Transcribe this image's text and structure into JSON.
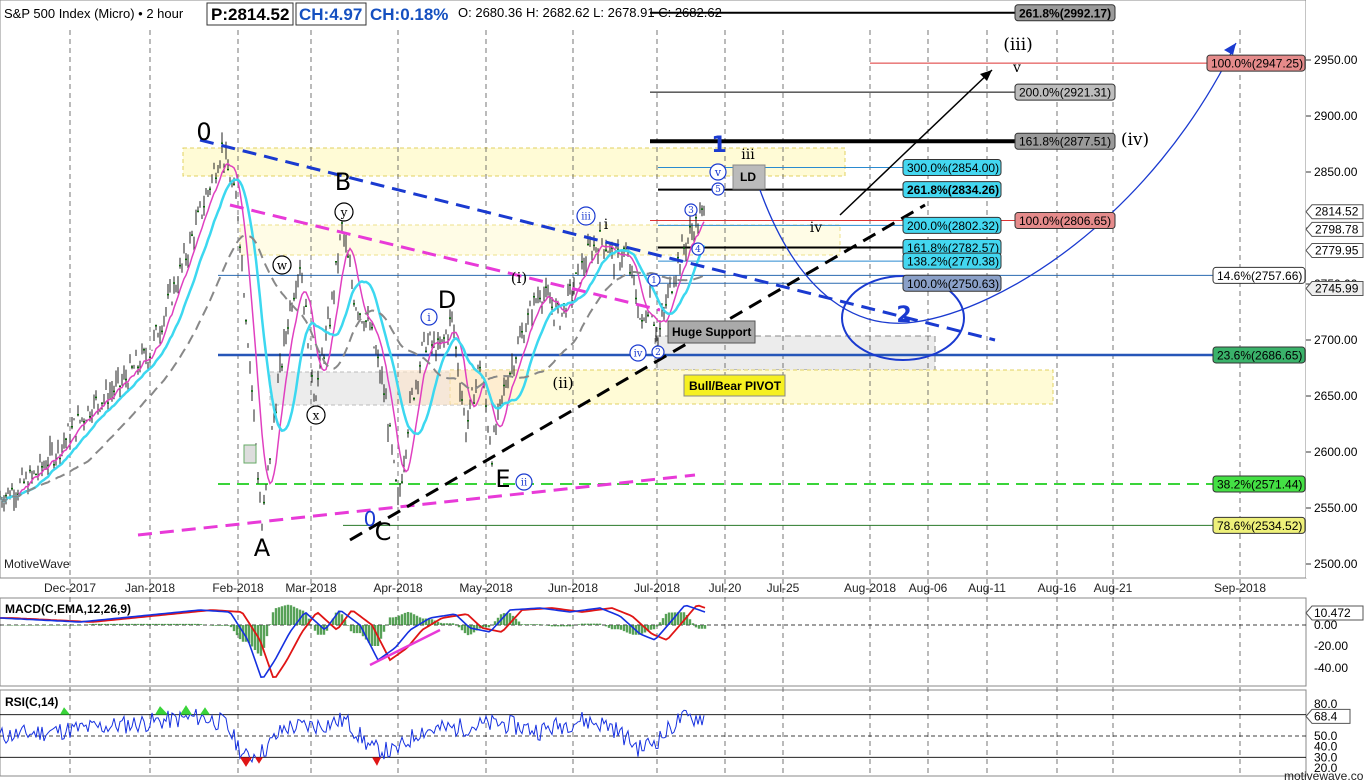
{
  "header": {
    "symbol": "S&P 500 Index (Micro) • 2 hour",
    "price_box": "P:2814.52",
    "change_box": "CH:4.97",
    "change_pct": "CH:0.18%",
    "ohlc": "O: 2680.36  H: 2682.62  L: 2678.91  C: 2682.62"
  },
  "watermark": "MotiveWave",
  "footer": "motivewave.com",
  "price_axis": {
    "ticks": [
      "2950.00",
      "2900.00",
      "2850.00",
      "2800.00",
      "2750.00",
      "2700.00",
      "2650.00",
      "2600.00",
      "2550.00",
      "2500.00"
    ],
    "current_labels": [
      "2814.52",
      "2798.78",
      "2779.95",
      "2745.99"
    ]
  },
  "time_axis": {
    "labels": [
      "Dec-2017",
      "Jan-2018",
      "Feb-2018",
      "Mar-2018",
      "Apr-2018",
      "May-2018",
      "Jun-2018",
      "Jul-2018",
      "Jul-20",
      "Jul-25",
      "Aug-2018",
      "Aug-06",
      "Aug-11",
      "Aug-16",
      "Aug-21",
      "Sep-2018"
    ]
  },
  "fib_labels": {
    "f2992": "261.8%(2992.17)",
    "f2947": "100.0%(2947.25)",
    "f2921": "200.0%(2921.31)",
    "f2877": "161.8%(2877.51)",
    "f2854": "300.0%(2854.00)",
    "f2834": "261.8%(2834.26)",
    "f2806": "100.0%(2806.65)",
    "f2802": "200.0%(2802.32)",
    "f2782": "161.8%(2782.57)",
    "f2770": "138.2%(2770.38)",
    "f2757": "14.6%(2757.66)",
    "f2750": "100.0%(2750.63)",
    "f2686": "23.6%(2686.65)",
    "f2571": "38.2%(2571.44)",
    "f2534": "78.6%(2534.52)"
  },
  "annotations": {
    "huge_support": "Huge Support",
    "pivot": "Bull/Bear PIVOT",
    "ld": "LD"
  },
  "wave_labels": {
    "w0": "0",
    "wA": "A",
    "wB": "B",
    "wC": "C",
    "wD": "D",
    "wE": "E",
    "w0b": "0",
    "w1": "1",
    "w2": "2",
    "wi": "(i)",
    "wii": "(ii)",
    "wiii": "(iii)",
    "wiv": "(iv)",
    "wsi": "i",
    "wsiii": "iii",
    "wsiv": "iv",
    "wsv": "v",
    "cw": "w",
    "cx": "x",
    "cy": "y",
    "c_i": "i",
    "c_ii": "ii",
    "c_iii": "iii",
    "c_iv": "iv",
    "c_v": "v",
    "c1": "1",
    "c2": "2",
    "c3": "3",
    "c4": "4",
    "c5": "5",
    "civ": "iv"
  },
  "macd": {
    "title": "MACD(C,EMA,12,26,9)",
    "ticks": [
      "10.472",
      "0.00",
      "-20.00",
      "-40.00"
    ]
  },
  "rsi": {
    "title": "RSI(C,14)",
    "ticks": [
      "80.0",
      "68.4",
      "50.0",
      "40.0",
      "30.0",
      "20.0"
    ]
  },
  "chart_data": {
    "type": "line",
    "title": "S&P 500 Index (Micro) • 2 hour",
    "ylim": [
      2490,
      3010
    ],
    "x": [
      "Dec-2017",
      "Jan-2018",
      "Feb-2018",
      "Mar-2018",
      "Apr-2018",
      "May-2018",
      "Jun-2018",
      "Jul-2018"
    ],
    "series": [
      {
        "name": "",
        "values": [
          2565,
          2690,
          2790,
          2705,
          2600,
          2660,
          2750,
          2760
        ]
      }
    ],
    "key_points": [
      {
        "x": "Jan-26-2018",
        "y": 2872
      },
      {
        "x": "Feb-09-2018",
        "y": 2532
      },
      {
        "x": "Mar-12-2018",
        "y": 2800
      },
      {
        "x": "Apr-02-2018",
        "y": 2553
      },
      {
        "x": "Jun-12-2018",
        "y": 2791
      },
      {
        "x": "Jul-17-2018",
        "y": 2814.52
      }
    ],
    "fib_levels": [
      2992.17,
      2947.25,
      2921.31,
      2877.51,
      2854.0,
      2834.26,
      2806.65,
      2802.32,
      2782.57,
      2770.38,
      2757.66,
      2750.63,
      2686.65,
      2571.44,
      2534.52
    ],
    "last_price": 2814.52
  }
}
